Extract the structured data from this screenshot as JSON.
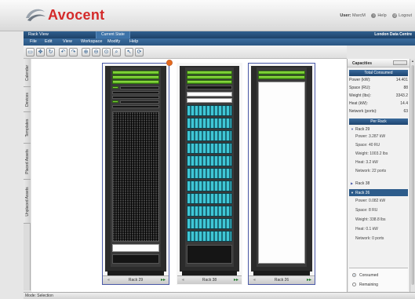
{
  "app": {
    "brand": "Avocent"
  },
  "user": {
    "label": "User:",
    "name": "MarcM",
    "help": "Help",
    "logout": "Logout"
  },
  "window": {
    "title": "Rack View",
    "current_state": "Current State",
    "location": "London Data Centre"
  },
  "menu": [
    "File",
    "Edit",
    "View",
    "Workspace",
    "Modify",
    "Help"
  ],
  "toolbar": {
    "icons": [
      "select-icon",
      "pan-icon",
      "refresh-icon",
      "undo-icon",
      "redo-icon",
      "zoom-in-icon",
      "zoom-out-icon",
      "zoom-fit-icon",
      "zoom-area-icon",
      "pointer-icon",
      "rotate-icon"
    ]
  },
  "side_tabs": [
    "Calendar",
    "Devices",
    "Templates",
    "Placed Assets",
    "Unplaced Assets"
  ],
  "racks": [
    {
      "name": "Rack 29",
      "selected": true
    },
    {
      "name": "Rack 38",
      "selected": false
    },
    {
      "name": "Rack 26",
      "selected": true
    }
  ],
  "capacities": {
    "title": "Capacities",
    "total_title": "Total Consumed",
    "total": [
      {
        "k": "Power (kW):",
        "v": "14.401"
      },
      {
        "k": "Space (RU):",
        "v": "88"
      },
      {
        "k": "Weight (lbs):",
        "v": "3343.2"
      },
      {
        "k": "Heat (kW):",
        "v": "14.4"
      },
      {
        "k": "Network (ports):",
        "v": "63"
      }
    ],
    "per_rack_title": "Per Rack",
    "per_rack": [
      {
        "name": "Rack 29",
        "expanded": true,
        "selected": false,
        "details": [
          "Power: 3.287 kW",
          "Space: 40 RU",
          "Weight: 1003.2 lbs",
          "Heat: 3.2 kW",
          "Network: 22 ports"
        ]
      },
      {
        "name": "Rack 38",
        "expanded": false,
        "selected": false,
        "details": []
      },
      {
        "name": "Rack 26",
        "expanded": true,
        "selected": true,
        "details": [
          "Power: 0.082 kW",
          "Space: 8 RU",
          "Weight: 338.8 lbs",
          "Heat: 0.1 kW",
          "Network: 0 ports"
        ]
      }
    ],
    "legend": [
      {
        "label": "Consumed",
        "checked": true
      },
      {
        "label": "Remaining",
        "checked": false
      }
    ]
  },
  "status": {
    "text": "Mode: Selection"
  }
}
